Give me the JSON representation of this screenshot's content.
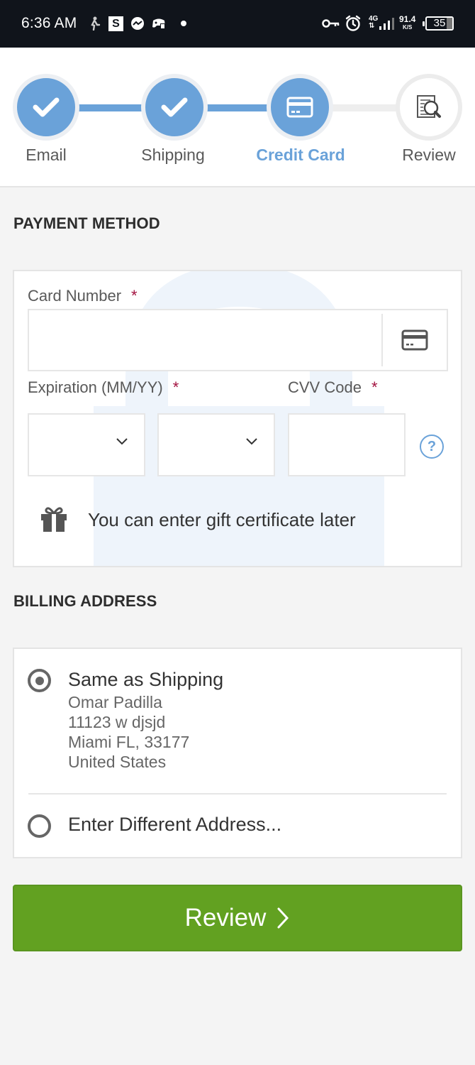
{
  "status_bar": {
    "time": "6:36 AM",
    "s_badge": "S",
    "network": "4G",
    "speed_value": "91.4",
    "speed_unit": "K/S",
    "battery": "35",
    "icons": [
      "person-walking-icon",
      "s-app-icon",
      "messenger-icon",
      "game-controller-icon",
      "dot-icon",
      "key-icon",
      "alarm-icon",
      "signal-icon",
      "battery-icon"
    ]
  },
  "stepper": {
    "steps": [
      {
        "label": "Email",
        "state": "complete",
        "icon": "check-icon"
      },
      {
        "label": "Shipping",
        "state": "complete",
        "icon": "check-icon"
      },
      {
        "label": "Credit Card",
        "state": "active",
        "icon": "credit-card-icon"
      },
      {
        "label": "Review",
        "state": "pending",
        "icon": "document-search-icon"
      }
    ]
  },
  "payment": {
    "title": "PAYMENT METHOD",
    "card_number_label": "Card Number",
    "card_number_value": "",
    "expiration_label": "Expiration (MM/YY)",
    "month_value": "",
    "year_value": "",
    "cvv_label": "CVV Code",
    "cvv_value": "",
    "required_mark": "*",
    "help_icon_text": "?",
    "gift_text": "You can enter gift certificate later"
  },
  "billing": {
    "title": "BILLING ADDRESS",
    "options": [
      {
        "label": "Same as Shipping",
        "selected": true
      },
      {
        "label": "Enter Different Address...",
        "selected": false
      }
    ],
    "address": {
      "name": "Omar Padilla",
      "street": "11123 w djsjd",
      "city_state_zip": "Miami FL, 33177",
      "country": "United States"
    }
  },
  "actions": {
    "review_label": "Review"
  },
  "colors": {
    "accent_blue": "#6aa2d9",
    "button_green": "#62a121",
    "required_red": "#a3123f"
  }
}
